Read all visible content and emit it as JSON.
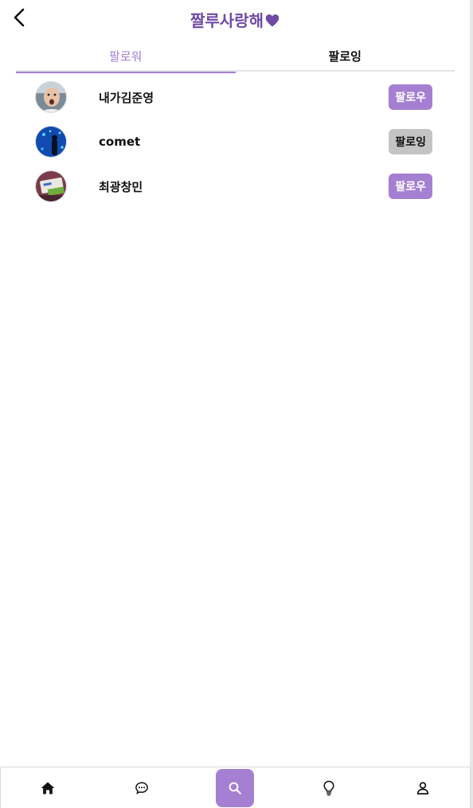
{
  "header": {
    "title": "짤루사랑해",
    "back_icon": "chevron-left-icon",
    "heart_icon": "heart-icon",
    "accent_color": "#6f4aa6"
  },
  "tabs": [
    {
      "label": "팔로워",
      "active": true
    },
    {
      "label": "팔로잉",
      "active": false
    }
  ],
  "users": [
    {
      "name": "내가김준영",
      "button": "팔로우",
      "button_style": "purple"
    },
    {
      "name": "comet",
      "button": "팔로잉",
      "button_style": "gray"
    },
    {
      "name": "최광창민",
      "button": "팔로우",
      "button_style": "purple"
    }
  ],
  "bottom_nav": {
    "items": [
      {
        "icon": "home-icon",
        "active": false
      },
      {
        "icon": "chat-icon",
        "active": false
      },
      {
        "icon": "search-icon",
        "active": true
      },
      {
        "icon": "lightbulb-icon",
        "active": false
      },
      {
        "icon": "user-icon",
        "active": false
      }
    ]
  },
  "colors": {
    "accent": "#a57fd1",
    "following_button": "#c4c4c4"
  }
}
